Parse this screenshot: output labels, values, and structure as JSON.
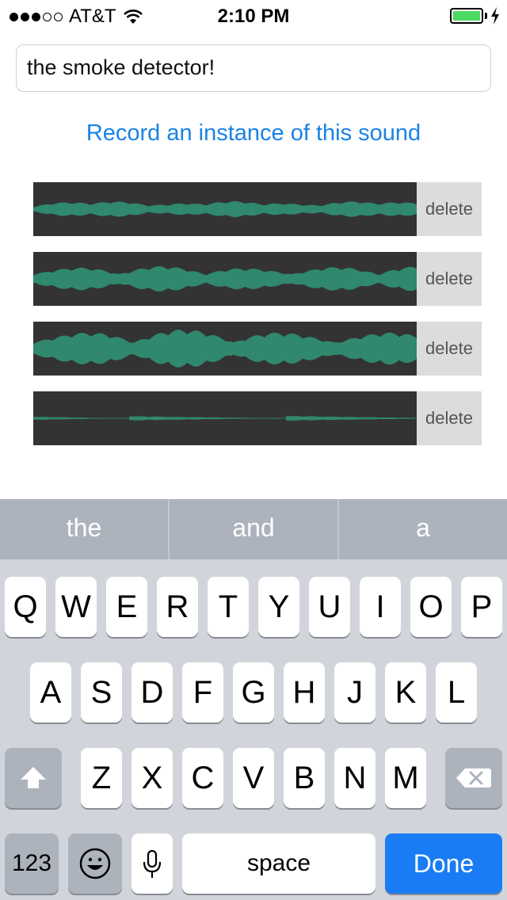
{
  "status": {
    "carrier": "AT&T",
    "time": "2:10 PM"
  },
  "name_field": {
    "value": "the smoke detector!"
  },
  "record_link": "Record an instance of this sound",
  "recordings": [
    {
      "delete_label": "delete"
    },
    {
      "delete_label": "delete"
    },
    {
      "delete_label": "delete"
    },
    {
      "delete_label": "delete"
    }
  ],
  "suggestions": [
    "the",
    "and",
    "a"
  ],
  "keyboard": {
    "row1": [
      "Q",
      "W",
      "E",
      "R",
      "T",
      "Y",
      "U",
      "I",
      "O",
      "P"
    ],
    "row2": [
      "A",
      "S",
      "D",
      "F",
      "G",
      "H",
      "J",
      "K",
      "L"
    ],
    "row3": [
      "Z",
      "X",
      "C",
      "V",
      "B",
      "N",
      "M"
    ],
    "numbers_label": "123",
    "space_label": "space",
    "done_label": "Done"
  },
  "colors": {
    "accent": "#1a82e6",
    "waveform": "#2f9e7e",
    "wave_bg": "#333333",
    "battery": "#4cd964"
  }
}
